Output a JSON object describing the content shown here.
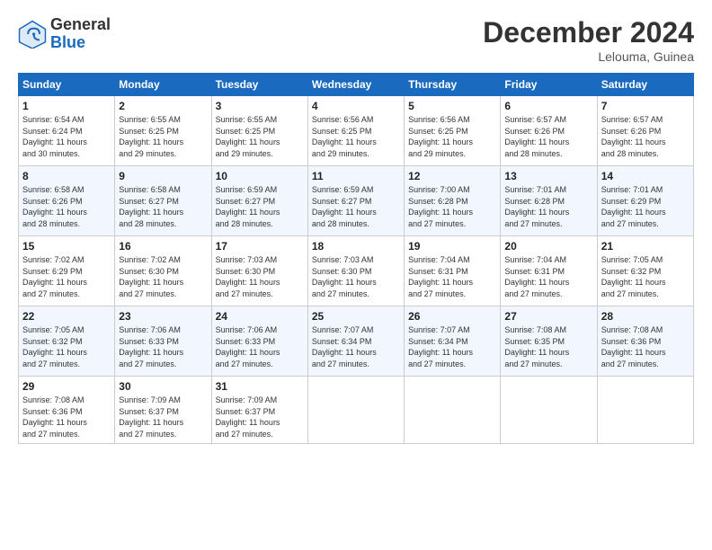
{
  "logo": {
    "general": "General",
    "blue": "Blue"
  },
  "title": "December 2024",
  "subtitle": "Lelouma, Guinea",
  "days_of_week": [
    "Sunday",
    "Monday",
    "Tuesday",
    "Wednesday",
    "Thursday",
    "Friday",
    "Saturday"
  ],
  "weeks": [
    [
      {
        "day": "1",
        "info": "Sunrise: 6:54 AM\nSunset: 6:24 PM\nDaylight: 11 hours\nand 30 minutes."
      },
      {
        "day": "2",
        "info": "Sunrise: 6:55 AM\nSunset: 6:25 PM\nDaylight: 11 hours\nand 29 minutes."
      },
      {
        "day": "3",
        "info": "Sunrise: 6:55 AM\nSunset: 6:25 PM\nDaylight: 11 hours\nand 29 minutes."
      },
      {
        "day": "4",
        "info": "Sunrise: 6:56 AM\nSunset: 6:25 PM\nDaylight: 11 hours\nand 29 minutes."
      },
      {
        "day": "5",
        "info": "Sunrise: 6:56 AM\nSunset: 6:25 PM\nDaylight: 11 hours\nand 29 minutes."
      },
      {
        "day": "6",
        "info": "Sunrise: 6:57 AM\nSunset: 6:26 PM\nDaylight: 11 hours\nand 28 minutes."
      },
      {
        "day": "7",
        "info": "Sunrise: 6:57 AM\nSunset: 6:26 PM\nDaylight: 11 hours\nand 28 minutes."
      }
    ],
    [
      {
        "day": "8",
        "info": "Sunrise: 6:58 AM\nSunset: 6:26 PM\nDaylight: 11 hours\nand 28 minutes."
      },
      {
        "day": "9",
        "info": "Sunrise: 6:58 AM\nSunset: 6:27 PM\nDaylight: 11 hours\nand 28 minutes."
      },
      {
        "day": "10",
        "info": "Sunrise: 6:59 AM\nSunset: 6:27 PM\nDaylight: 11 hours\nand 28 minutes."
      },
      {
        "day": "11",
        "info": "Sunrise: 6:59 AM\nSunset: 6:27 PM\nDaylight: 11 hours\nand 28 minutes."
      },
      {
        "day": "12",
        "info": "Sunrise: 7:00 AM\nSunset: 6:28 PM\nDaylight: 11 hours\nand 27 minutes."
      },
      {
        "day": "13",
        "info": "Sunrise: 7:01 AM\nSunset: 6:28 PM\nDaylight: 11 hours\nand 27 minutes."
      },
      {
        "day": "14",
        "info": "Sunrise: 7:01 AM\nSunset: 6:29 PM\nDaylight: 11 hours\nand 27 minutes."
      }
    ],
    [
      {
        "day": "15",
        "info": "Sunrise: 7:02 AM\nSunset: 6:29 PM\nDaylight: 11 hours\nand 27 minutes."
      },
      {
        "day": "16",
        "info": "Sunrise: 7:02 AM\nSunset: 6:30 PM\nDaylight: 11 hours\nand 27 minutes."
      },
      {
        "day": "17",
        "info": "Sunrise: 7:03 AM\nSunset: 6:30 PM\nDaylight: 11 hours\nand 27 minutes."
      },
      {
        "day": "18",
        "info": "Sunrise: 7:03 AM\nSunset: 6:30 PM\nDaylight: 11 hours\nand 27 minutes."
      },
      {
        "day": "19",
        "info": "Sunrise: 7:04 AM\nSunset: 6:31 PM\nDaylight: 11 hours\nand 27 minutes."
      },
      {
        "day": "20",
        "info": "Sunrise: 7:04 AM\nSunset: 6:31 PM\nDaylight: 11 hours\nand 27 minutes."
      },
      {
        "day": "21",
        "info": "Sunrise: 7:05 AM\nSunset: 6:32 PM\nDaylight: 11 hours\nand 27 minutes."
      }
    ],
    [
      {
        "day": "22",
        "info": "Sunrise: 7:05 AM\nSunset: 6:32 PM\nDaylight: 11 hours\nand 27 minutes."
      },
      {
        "day": "23",
        "info": "Sunrise: 7:06 AM\nSunset: 6:33 PM\nDaylight: 11 hours\nand 27 minutes."
      },
      {
        "day": "24",
        "info": "Sunrise: 7:06 AM\nSunset: 6:33 PM\nDaylight: 11 hours\nand 27 minutes."
      },
      {
        "day": "25",
        "info": "Sunrise: 7:07 AM\nSunset: 6:34 PM\nDaylight: 11 hours\nand 27 minutes."
      },
      {
        "day": "26",
        "info": "Sunrise: 7:07 AM\nSunset: 6:34 PM\nDaylight: 11 hours\nand 27 minutes."
      },
      {
        "day": "27",
        "info": "Sunrise: 7:08 AM\nSunset: 6:35 PM\nDaylight: 11 hours\nand 27 minutes."
      },
      {
        "day": "28",
        "info": "Sunrise: 7:08 AM\nSunset: 6:36 PM\nDaylight: 11 hours\nand 27 minutes."
      }
    ],
    [
      {
        "day": "29",
        "info": "Sunrise: 7:08 AM\nSunset: 6:36 PM\nDaylight: 11 hours\nand 27 minutes."
      },
      {
        "day": "30",
        "info": "Sunrise: 7:09 AM\nSunset: 6:37 PM\nDaylight: 11 hours\nand 27 minutes."
      },
      {
        "day": "31",
        "info": "Sunrise: 7:09 AM\nSunset: 6:37 PM\nDaylight: 11 hours\nand 27 minutes."
      },
      {
        "day": "",
        "info": ""
      },
      {
        "day": "",
        "info": ""
      },
      {
        "day": "",
        "info": ""
      },
      {
        "day": "",
        "info": ""
      }
    ]
  ]
}
